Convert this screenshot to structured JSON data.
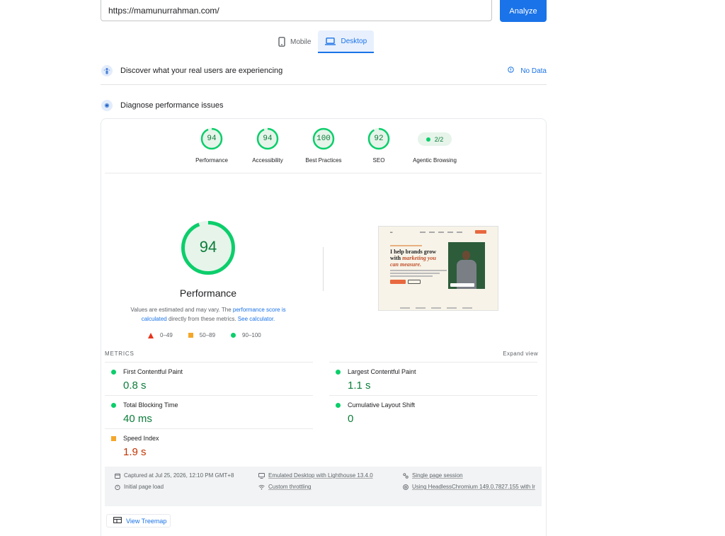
{
  "search": {
    "url_value": "https://mamunurrahman.com/",
    "analyze_label": "Analyze"
  },
  "device_tabs": [
    {
      "label": "Mobile",
      "icon": "smartphone-icon",
      "active": false
    },
    {
      "label": "Desktop",
      "icon": "laptop-icon",
      "active": true
    }
  ],
  "crux": {
    "title": "Discover what your real users are experiencing",
    "status": "No Data"
  },
  "diagnose": {
    "title": "Diagnose performance issues"
  },
  "categories": [
    {
      "label": "Performance",
      "score": "94"
    },
    {
      "label": "Accessibility",
      "score": "94"
    },
    {
      "label": "Best Practices",
      "score": "100"
    },
    {
      "label": "SEO",
      "score": "92"
    },
    {
      "label": "Agentic Browsing",
      "badge": "2/2"
    }
  ],
  "performance": {
    "score": "94",
    "title": "Performance",
    "note_prefix": "Values are estimated and may vary. The ",
    "note_link1": "performance score is calculated",
    "note_middle": " directly from these metrics. ",
    "note_link2": "See calculator."
  },
  "legend": {
    "fail": "0–49",
    "average": "50–89",
    "pass": "90–100"
  },
  "thumbnail": {
    "headline_1": "I help brands grow",
    "headline_2_pre": "with ",
    "headline_2_em": "marketing you",
    "headline_3": "can measure."
  },
  "metrics": {
    "heading": "METRICS",
    "expand_label": "Expand view",
    "items": [
      {
        "label": "First Contentful Paint",
        "value": "0.8 s",
        "rating": "pass"
      },
      {
        "label": "Largest Contentful Paint",
        "value": "1.1 s",
        "rating": "pass"
      },
      {
        "label": "Total Blocking Time",
        "value": "40 ms",
        "rating": "pass"
      },
      {
        "label": "Cumulative Layout Shift",
        "value": "0",
        "rating": "pass"
      },
      {
        "label": "Speed Index",
        "value": "1.9 s",
        "rating": "average"
      }
    ]
  },
  "run_info": {
    "captured": "Captured at Jul 25, 2026, 12:10 PM GMT+8",
    "load": "Initial page load",
    "emulation": "Emulated Desktop with Lighthouse 13.4.0",
    "throttling": "Custom throttling",
    "session": "Single page session",
    "browser": "Using HeadlessChromium 149.0.7827.155 with lr"
  },
  "treemap_label": "View Treemap",
  "colors": {
    "accent": "#1a73e8",
    "pass": "#0cce6b",
    "pass_text": "#0c7d3a",
    "average": "#f4a72a",
    "average_text": "#c33300",
    "fail": "#e8341c"
  }
}
